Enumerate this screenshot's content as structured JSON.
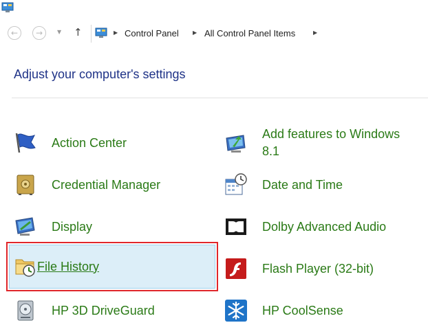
{
  "window": {
    "icon": "control-panel-icon"
  },
  "navigation": {
    "back_icon": "back-arrow-icon",
    "forward_icon": "forward-arrow-icon",
    "recent_icon": "chevron-down-icon",
    "up_icon": "up-arrow-icon",
    "breadcrumb": [
      "Control Panel",
      "All Control Panel Items"
    ]
  },
  "page_title": "Adjust your computer's settings",
  "items": {
    "left": [
      {
        "label": "Action Center",
        "icon": "flag-icon"
      },
      {
        "label": "Credential Manager",
        "icon": "safe-icon"
      },
      {
        "label": "Display",
        "icon": "monitor-icon"
      },
      {
        "label": "File History",
        "icon": "folder-clock-icon",
        "selected": true,
        "highlighted": true
      },
      {
        "label": "HP 3D DriveGuard",
        "icon": "hard-drive-icon"
      }
    ],
    "right": [
      {
        "label_line1": "Add features to Windows",
        "label_line2": "8.1",
        "icon": "computer-arrow-icon"
      },
      {
        "label": "Date and Time",
        "icon": "calendar-clock-icon"
      },
      {
        "label": "Dolby Advanced Audio",
        "icon": "dolby-icon"
      },
      {
        "label": "Flash Player (32-bit)",
        "icon": "flash-icon"
      },
      {
        "label": "HP CoolSense",
        "icon": "snowflake-icon"
      }
    ]
  },
  "colors": {
    "link": "#2a7a16",
    "title": "#1e3287",
    "highlight_border": "#e0262b",
    "selected_bg": "#dceef8"
  }
}
